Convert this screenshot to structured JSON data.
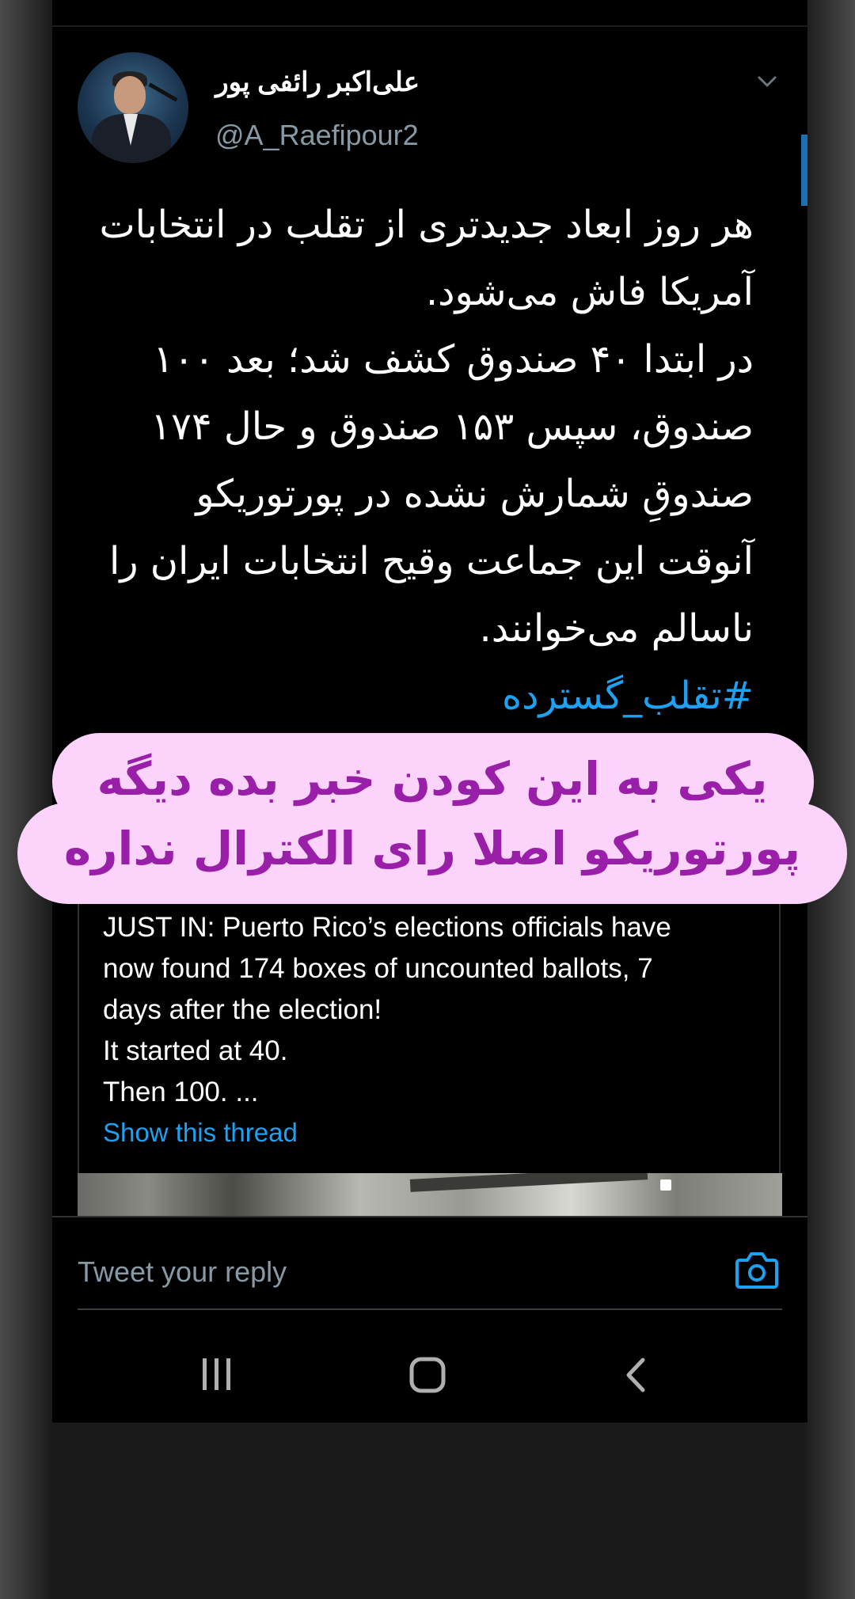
{
  "tweet": {
    "author_name": "علی‌اکبر رائفی پور",
    "author_handle": "@A_Raefipour2",
    "lines": [
      "هر روز ابعاد جدیدتری از تقلب در انتخابات",
      "آمریکا فاش می‌شود.",
      "در ابتدا ۴۰ صندوق کشف شد؛ بعد ۱۰۰",
      "صندوق، سپس ۱۵۳ صندوق و حال ۱۷۴",
      "صندوقِ شمارش نشده در پورتوریکو",
      "آنوقت این جماعت وقیح انتخابات ایران را",
      "ناسالم می‌خوانند."
    ],
    "hashtag": "#تقلب_گسترده"
  },
  "overlay": {
    "line1": "یکی به این کودن خبر بده دیگه",
    "line2": "پورتوریکو اصلا رای الکترال نداره",
    "bg_color": "#fbd3fb",
    "text_color": "#9a1fa8"
  },
  "quoted_tweet": {
    "lines": [
      "JUST IN: Puerto Rico’s elections officials have",
      "now found 174 boxes of uncounted ballots, 7",
      "days after the election!",
      "It started at 40.",
      "Then 100. ..."
    ],
    "show_thread": "Show this thread"
  },
  "reply": {
    "placeholder": "Tweet your reply",
    "camera_icon": "camera-icon"
  },
  "navbar": {
    "recent_icon": "recent-apps-icon",
    "home_icon": "home-icon",
    "back_icon": "back-icon"
  },
  "colors": {
    "accent": "#1da1f2",
    "background": "#000000",
    "secondary_text": "#8899a6"
  }
}
